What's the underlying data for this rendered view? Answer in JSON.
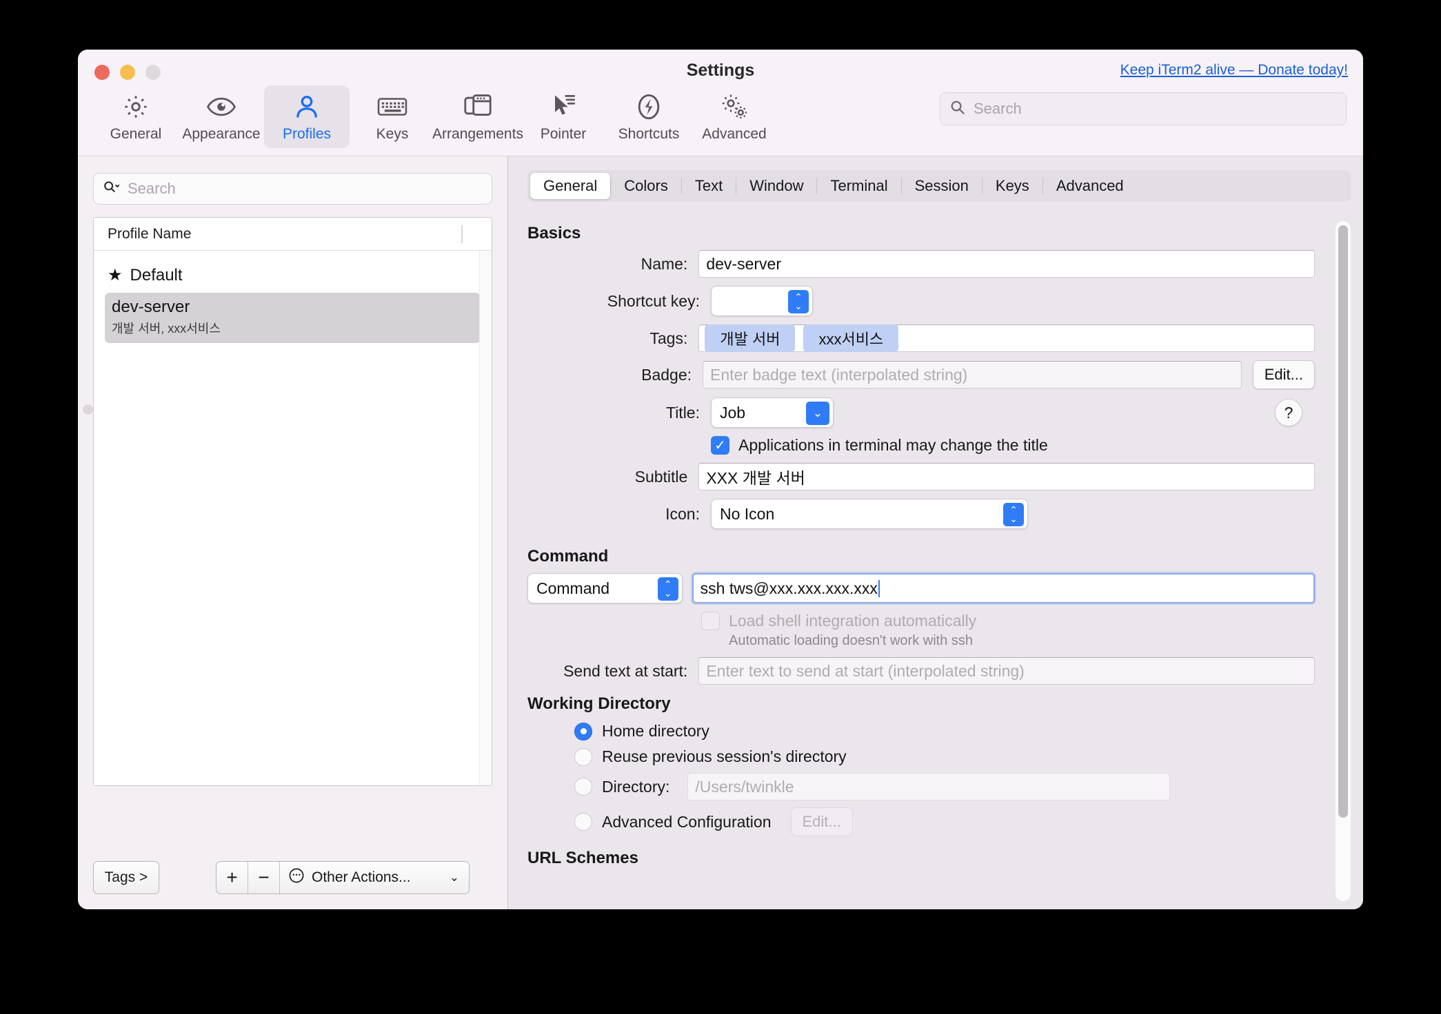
{
  "window": {
    "title": "Settings",
    "donate_link": "Keep iTerm2 alive — Donate today!"
  },
  "toolbar": {
    "items": [
      {
        "label": "General",
        "icon": "gear-icon",
        "active": false
      },
      {
        "label": "Appearance",
        "icon": "eye-icon",
        "active": false
      },
      {
        "label": "Profiles",
        "icon": "person-icon",
        "active": true
      },
      {
        "label": "Keys",
        "icon": "keyboard-icon",
        "active": false
      },
      {
        "label": "Arrangements",
        "icon": "windows-icon",
        "active": false
      },
      {
        "label": "Pointer",
        "icon": "cursor-icon",
        "active": false
      },
      {
        "label": "Shortcuts",
        "icon": "bolt-icon",
        "active": false
      },
      {
        "label": "Advanced",
        "icon": "gears-icon",
        "active": false
      }
    ],
    "search_placeholder": "Search"
  },
  "sidebar": {
    "search_placeholder": "Search",
    "column_header": "Profile Name",
    "profiles": [
      {
        "name": "Default",
        "starred": true,
        "tags": "",
        "selected": false
      },
      {
        "name": "dev-server",
        "starred": false,
        "tags": "개발 서버, xxx서비스",
        "selected": true
      }
    ],
    "tags_button": "Tags >",
    "add_button": "+",
    "remove_button": "−",
    "other_actions": "Other Actions..."
  },
  "tabs": [
    {
      "label": "General",
      "active": true
    },
    {
      "label": "Colors",
      "active": false
    },
    {
      "label": "Text",
      "active": false
    },
    {
      "label": "Window",
      "active": false
    },
    {
      "label": "Terminal",
      "active": false
    },
    {
      "label": "Session",
      "active": false
    },
    {
      "label": "Keys",
      "active": false
    },
    {
      "label": "Advanced",
      "active": false
    }
  ],
  "general": {
    "basics_heading": "Basics",
    "name_label": "Name:",
    "name_value": "dev-server",
    "shortcut_label": "Shortcut key:",
    "shortcut_value": "",
    "tags_label": "Tags:",
    "tags": [
      "개발 서버",
      "xxx서비스"
    ],
    "badge_label": "Badge:",
    "badge_placeholder": "Enter badge text (interpolated string)",
    "badge_edit_button": "Edit...",
    "title_label": "Title:",
    "title_value": "Job",
    "help_button": "?",
    "apps_change_title_label": "Applications in terminal may change the title",
    "apps_change_title_checked": true,
    "subtitle_label": "Subtitle",
    "subtitle_value": "XXX 개발 서버",
    "icon_label": "Icon:",
    "icon_value": "No Icon",
    "command_heading": "Command",
    "command_mode": "Command",
    "command_value": "ssh tws@xxx.xxx.xxx.xxx",
    "shell_integration_label": "Load shell integration automatically",
    "shell_integration_checked": false,
    "shell_integration_note": "Automatic loading doesn't work with ssh",
    "send_text_label": "Send text at start:",
    "send_text_placeholder": "Enter text to send at start (interpolated string)",
    "working_dir_heading": "Working Directory",
    "wd_home": "Home directory",
    "wd_reuse": "Reuse previous session's directory",
    "wd_directory_label": "Directory:",
    "wd_directory_placeholder": "/Users/twinkle",
    "wd_advanced": "Advanced Configuration",
    "wd_advanced_edit": "Edit...",
    "url_schemes_heading": "URL Schemes"
  }
}
